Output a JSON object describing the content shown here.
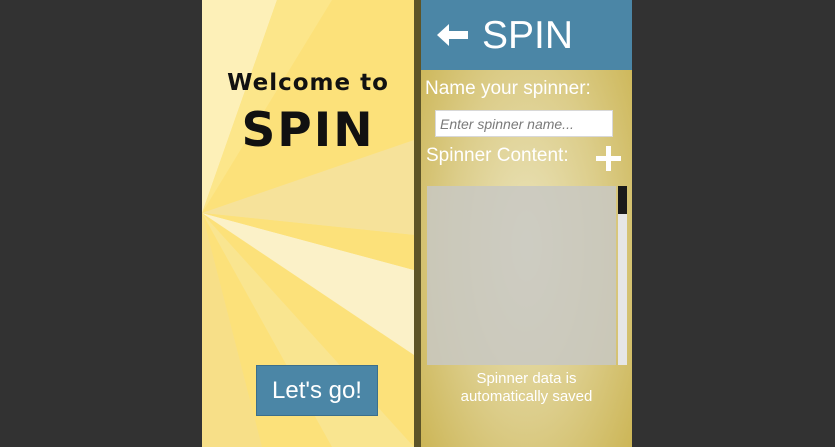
{
  "welcome_screen": {
    "welcome_text": "Welcome to",
    "app_name": "SPIN",
    "go_button_label": "Let's go!"
  },
  "editor_screen": {
    "header": {
      "back_icon": "left-arrow-icon",
      "title": "SPIN"
    },
    "name_label": "Name your spinner:",
    "name_input": {
      "value": "",
      "placeholder": "Enter spinner name..."
    },
    "content_label": "Spinner Content:",
    "add_icon": "plus-icon",
    "footer_note_line1": "Spinner data is",
    "footer_note_line2": "automatically saved"
  },
  "colors": {
    "background": "#323232",
    "yellow_panel": "#fce17a",
    "accent_blue": "#4b86a6",
    "divider": "#5d5427"
  }
}
